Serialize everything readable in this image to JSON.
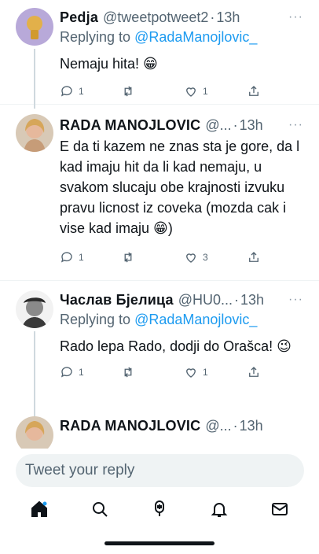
{
  "tweets": [
    {
      "name": "Pedja",
      "handle": "@tweetpotweet2",
      "time": "13h",
      "replying_prefix": "Replying to ",
      "replying_to": "@RadaManojlovic_",
      "text": "Nemaju hita! 😁",
      "replies": "1",
      "retweets": "",
      "likes": "1"
    },
    {
      "name": "RADA MANOJLOVIC",
      "handle": "@...",
      "time": "13h",
      "text": "E da ti kazem ne znas sta je gore, da l kad imaju hit da li kad nemaju, u svakom slucaju obe krajnosti izvuku pravu licnost iz coveka (mozda cak i vise kad imaju 😁)",
      "replies": "1",
      "retweets": "",
      "likes": "3"
    },
    {
      "name": "Часлав Бјелица",
      "handle": "@HU0...",
      "time": "13h",
      "replying_prefix": "Replying to ",
      "replying_to": "@RadaManojlovic_",
      "text": "Rado lepa Rado, dodji do Orašca! 😉",
      "replies": "1",
      "retweets": "",
      "likes": "1"
    },
    {
      "name": "RADA MANOJLOVIC",
      "handle": "@...",
      "time": "13h"
    }
  ],
  "separator": "·",
  "more_glyph": "···",
  "composer": {
    "placeholder": "Tweet your reply"
  },
  "tabbar": [
    "home-icon",
    "search-icon",
    "spaces-icon",
    "notifications-icon",
    "messages-icon"
  ],
  "colors": {
    "accent": "#1d9bf0",
    "text": "#0f1419",
    "muted": "#536471"
  }
}
